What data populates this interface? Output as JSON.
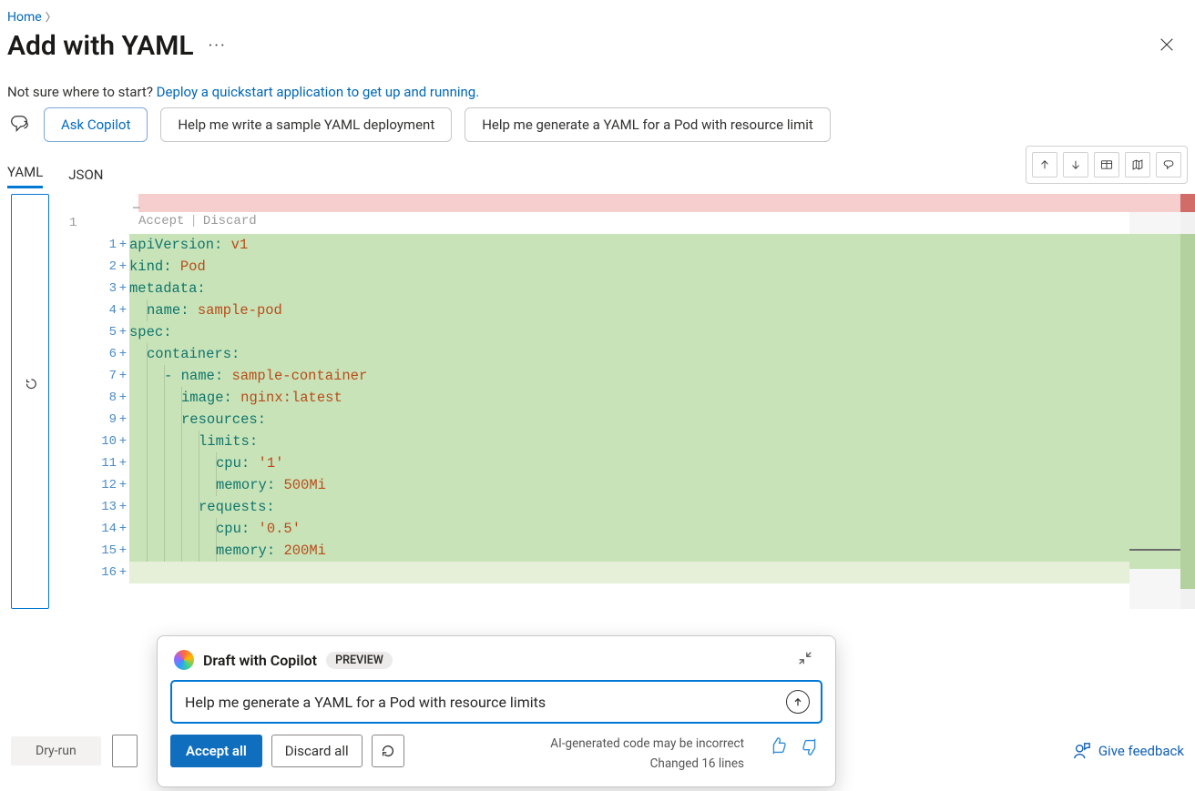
{
  "breadcrumb": {
    "home": "Home"
  },
  "page": {
    "title": "Add with YAML",
    "hint_prefix": "Not sure where to start?  ",
    "hint_link": "Deploy a quickstart application to get up and running."
  },
  "prompts": {
    "ask": "Ask Copilot",
    "p1": "Help me write a sample YAML deployment",
    "p2": "Help me generate a YAML for a Pod with resource limit"
  },
  "tabs": {
    "yaml": "YAML",
    "json": "JSON"
  },
  "editor": {
    "codelens_accept": "Accept",
    "codelens_discard": "Discard",
    "line_old": "1",
    "yaml_lines": [
      {
        "n": 1,
        "tokens": [
          [
            "key",
            "apiVersion"
          ],
          [
            "colon",
            ":"
          ],
          [
            "plain",
            " "
          ],
          [
            "str",
            "v1"
          ]
        ]
      },
      {
        "n": 2,
        "tokens": [
          [
            "key",
            "kind"
          ],
          [
            "colon",
            ":"
          ],
          [
            "plain",
            " "
          ],
          [
            "str",
            "Pod"
          ]
        ]
      },
      {
        "n": 3,
        "tokens": [
          [
            "key",
            "metadata"
          ],
          [
            "colon",
            ":"
          ]
        ]
      },
      {
        "n": 4,
        "indent": 1,
        "tokens": [
          [
            "key",
            "name"
          ],
          [
            "colon",
            ":"
          ],
          [
            "plain",
            " "
          ],
          [
            "str",
            "sample-pod"
          ]
        ]
      },
      {
        "n": 5,
        "tokens": [
          [
            "key",
            "spec"
          ],
          [
            "colon",
            ":"
          ]
        ]
      },
      {
        "n": 6,
        "indent": 1,
        "tokens": [
          [
            "key",
            "containers"
          ],
          [
            "colon",
            ":"
          ]
        ]
      },
      {
        "n": 7,
        "indent": 2,
        "tokens": [
          [
            "dash",
            "- "
          ],
          [
            "key",
            "name"
          ],
          [
            "colon",
            ":"
          ],
          [
            "plain",
            " "
          ],
          [
            "str",
            "sample-container"
          ]
        ]
      },
      {
        "n": 8,
        "indent": 3,
        "tokens": [
          [
            "key",
            "image"
          ],
          [
            "colon",
            ":"
          ],
          [
            "plain",
            " "
          ],
          [
            "str",
            "nginx:latest"
          ]
        ]
      },
      {
        "n": 9,
        "indent": 3,
        "tokens": [
          [
            "key",
            "resources"
          ],
          [
            "colon",
            ":"
          ]
        ]
      },
      {
        "n": 10,
        "indent": 4,
        "tokens": [
          [
            "key",
            "limits"
          ],
          [
            "colon",
            ":"
          ]
        ]
      },
      {
        "n": 11,
        "indent": 5,
        "tokens": [
          [
            "key",
            "cpu"
          ],
          [
            "colon",
            ":"
          ],
          [
            "plain",
            " "
          ],
          [
            "str",
            "'1'"
          ]
        ]
      },
      {
        "n": 12,
        "indent": 5,
        "tokens": [
          [
            "key",
            "memory"
          ],
          [
            "colon",
            ":"
          ],
          [
            "plain",
            " "
          ],
          [
            "str",
            "500Mi"
          ]
        ]
      },
      {
        "n": 13,
        "indent": 4,
        "tokens": [
          [
            "key",
            "requests"
          ],
          [
            "colon",
            ":"
          ]
        ]
      },
      {
        "n": 14,
        "indent": 5,
        "tokens": [
          [
            "key",
            "cpu"
          ],
          [
            "colon",
            ":"
          ],
          [
            "plain",
            " "
          ],
          [
            "str",
            "'0.5'"
          ]
        ]
      },
      {
        "n": 15,
        "indent": 5,
        "tokens": [
          [
            "key",
            "memory"
          ],
          [
            "colon",
            ":"
          ],
          [
            "plain",
            " "
          ],
          [
            "str",
            "200Mi"
          ]
        ]
      },
      {
        "n": 16,
        "indent": 0,
        "tokens": []
      }
    ]
  },
  "copilot": {
    "title": "Draft with Copilot",
    "badge": "PREVIEW",
    "input_value": "Help me generate a YAML for a Pod with resource limits",
    "accept": "Accept all",
    "discard": "Discard all",
    "meta1": "AI-generated code may be incorrect",
    "meta2": "Changed 16 lines"
  },
  "footer": {
    "dryrun": "Dry-run",
    "feedback": "Give feedback"
  }
}
